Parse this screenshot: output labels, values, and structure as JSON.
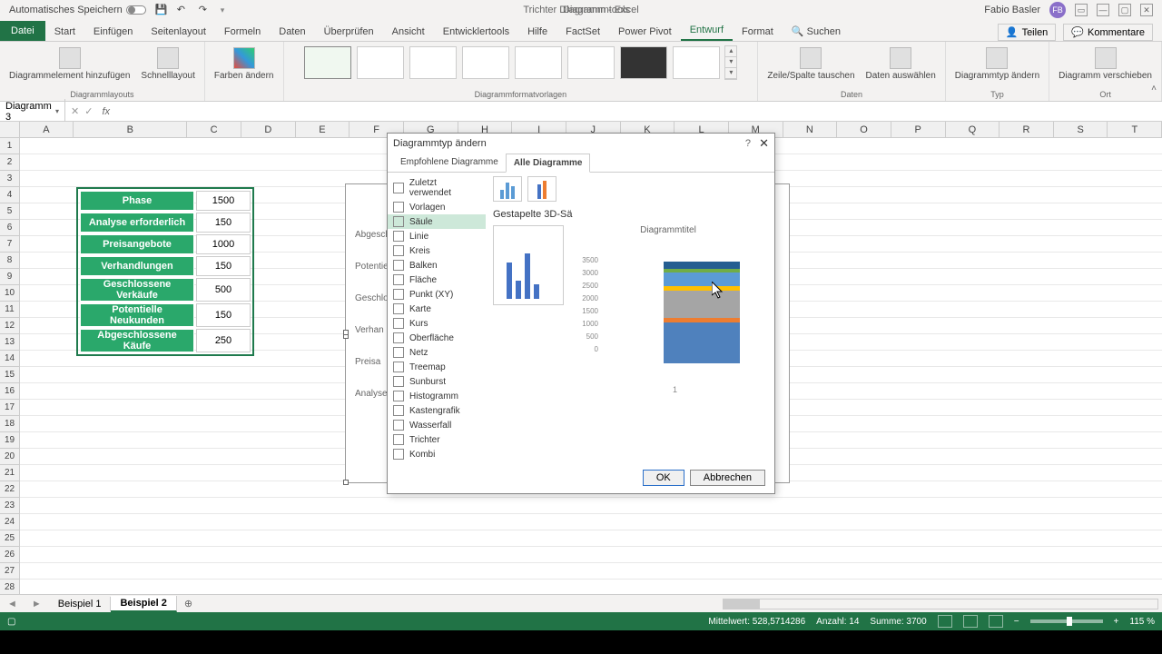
{
  "titlebar": {
    "autosave": "Automatisches Speichern",
    "doc_title": "Trichter Diagramm - Excel",
    "tools_title": "Diagrammtools",
    "user_name": "Fabio Basler",
    "user_initials": "FB"
  },
  "ribbon_tabs": {
    "file": "Datei",
    "tabs": [
      "Start",
      "Einfügen",
      "Seitenlayout",
      "Formeln",
      "Daten",
      "Überprüfen",
      "Ansicht",
      "Entwicklertools",
      "Hilfe",
      "FactSet",
      "Power Pivot",
      "Entwurf",
      "Format"
    ],
    "active": "Entwurf",
    "search": "Suchen",
    "share": "Teilen",
    "comments": "Kommentare"
  },
  "ribbon": {
    "group_layouts": "Diagrammlayouts",
    "add_element": "Diagrammelement hinzufügen",
    "quick_layout": "Schnelllayout",
    "change_colors": "Farben ändern",
    "group_styles": "Diagrammformatvorlagen",
    "switch_rowcol": "Zeile/Spalte tauschen",
    "select_data": "Daten auswählen",
    "group_data": "Daten",
    "change_type": "Diagrammtyp ändern",
    "group_type": "Typ",
    "move_chart": "Diagramm verschieben",
    "group_location": "Ort"
  },
  "namebox": "Diagramm 3",
  "formula": "",
  "columns": [
    "A",
    "B",
    "C",
    "D",
    "E",
    "F",
    "G",
    "H",
    "I",
    "J",
    "K",
    "L",
    "M",
    "N",
    "O",
    "P",
    "Q",
    "R",
    "S",
    "T"
  ],
  "worksheet_data": {
    "header": {
      "phase": "Phase",
      "value": "1500"
    },
    "rows": [
      {
        "phase": "Analyse erforderlich",
        "value": "150"
      },
      {
        "phase": "Preisangebote",
        "value": "1000"
      },
      {
        "phase": "Verhandlungen",
        "value": "150"
      },
      {
        "phase": "Geschlossene Verkäufe",
        "value": "500"
      },
      {
        "phase": "Potentielle Neukunden",
        "value": "150"
      },
      {
        "phase": "Abgeschlossene Käufe",
        "value": "250"
      }
    ]
  },
  "embedded_chart_labels": [
    "Abgeschlossen",
    "Potentielle Neu",
    "Geschlossene V",
    "Verhan",
    "Preisa",
    "Analyse erfo"
  ],
  "dialog": {
    "title": "Diagrammtyp ändern",
    "tab_recommended": "Empfohlene Diagramme",
    "tab_all": "Alle Diagramme",
    "types": [
      "Zuletzt verwendet",
      "Vorlagen",
      "Säule",
      "Linie",
      "Kreis",
      "Balken",
      "Fläche",
      "Punkt (XY)",
      "Karte",
      "Kurs",
      "Oberfläche",
      "Netz",
      "Treemap",
      "Sunburst",
      "Histogramm",
      "Kastengrafik",
      "Wasserfall",
      "Trichter",
      "Kombi"
    ],
    "selected_type": "Säule",
    "preview_label": "Gestapelte 3D-Sä",
    "preview_title": "Diagrammtitel",
    "axis_ticks": [
      "3500",
      "3000",
      "2500",
      "2000",
      "1500",
      "1000",
      "500",
      "0"
    ],
    "x_tick": "1",
    "ok": "OK",
    "cancel": "Abbrechen"
  },
  "chart_data": {
    "type": "bar",
    "subtype": "stacked_3d_column",
    "title": "Diagrammtitel",
    "xlabel": "",
    "ylabel": "",
    "ylim": [
      0,
      3500
    ],
    "categories": [
      "1"
    ],
    "series": [
      {
        "name": "Phase",
        "values": [
          1500
        ],
        "color": "#4f81bd"
      },
      {
        "name": "Analyse erforderlich",
        "values": [
          150
        ],
        "color": "#ed7d31"
      },
      {
        "name": "Preisangebote",
        "values": [
          1000
        ],
        "color": "#a5a5a5"
      },
      {
        "name": "Verhandlungen",
        "values": [
          150
        ],
        "color": "#ffc000"
      },
      {
        "name": "Geschlossene Verkäufe",
        "values": [
          500
        ],
        "color": "#5b9bd5"
      },
      {
        "name": "Potentielle Neukunden",
        "values": [
          150
        ],
        "color": "#70ad47"
      },
      {
        "name": "Abgeschlossene Käufe",
        "values": [
          250
        ],
        "color": "#255e91"
      }
    ]
  },
  "sheet_tabs": {
    "sheets": [
      "Beispiel 1",
      "Beispiel 2"
    ],
    "active": "Beispiel 2"
  },
  "statusbar": {
    "avg": "Mittelwert: 528,5714286",
    "count": "Anzahl: 14",
    "sum": "Summe: 3700",
    "zoom": "115 %"
  }
}
